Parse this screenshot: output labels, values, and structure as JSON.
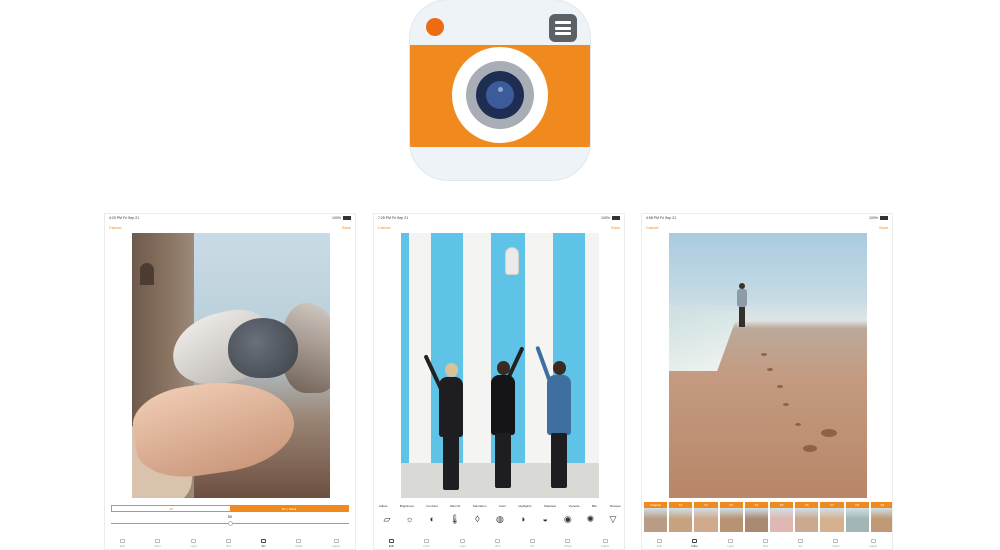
{
  "app_icon": {
    "colors": {
      "band": "#f08a1e",
      "dot": "#ee6b16",
      "menu": "#5b6167",
      "background": "#eef3f7"
    },
    "icons": [
      "camera-lens-icon",
      "menu-icon"
    ]
  },
  "screens": [
    {
      "status": {
        "time": "4:29 PM  Fri Sep 21",
        "battery": "100%"
      },
      "topbar": {
        "cancel": "Cancel",
        "save": "Save"
      },
      "adjust": {
        "left_option": "2D",
        "right_option": "3D + Mask",
        "value": "50",
        "slider_value": 50
      },
      "tabs": [
        "Edit",
        "Filter",
        "Light",
        "Blur",
        "3D",
        "Mask",
        "Adjust"
      ],
      "active_tab": 4
    },
    {
      "status": {
        "time": "7:25 PM  Fri Sep 21",
        "battery": "100%"
      },
      "topbar": {
        "cancel": "Cancel",
        "save": "Save"
      },
      "tools": [
        "Adjust",
        "Brightness",
        "Contrast",
        "Warmth",
        "Saturation",
        "Color",
        "Highlights",
        "Shadows",
        "Vignette",
        "Blur",
        "Sharpen"
      ],
      "tool_icons": [
        "crop-icon",
        "sun-icon",
        "contrast-icon",
        "thermometer-icon",
        "drop-icon",
        "tint-icon",
        "highlights-icon",
        "shadows-icon",
        "vignette-icon",
        "blur-icon",
        "triangle-icon"
      ],
      "tabs": [
        "Edit",
        "Filter",
        "Light",
        "Blur",
        "3D",
        "Mask",
        "Adjust"
      ],
      "active_tab": 0
    },
    {
      "status": {
        "time": "4:58 PM  Fri Sep 21",
        "battery": "100%"
      },
      "topbar": {
        "cancel": "Cancel",
        "save": "Save"
      },
      "filters": [
        {
          "label": "Original",
          "color": "#b89c85"
        },
        {
          "label": "F1",
          "color": "#c7a27e"
        },
        {
          "label": "F2",
          "color": "#d1a98c"
        },
        {
          "label": "F3",
          "color": "#b79374"
        },
        {
          "label": "F4",
          "color": "#a98972"
        },
        {
          "label": "F5",
          "color": "#e0b7b2"
        },
        {
          "label": "F6",
          "color": "#caa98f"
        },
        {
          "label": "F7",
          "color": "#d6b190"
        },
        {
          "label": "F8",
          "color": "#a2b6b6"
        },
        {
          "label": "F9",
          "color": "#c09a74"
        }
      ],
      "tabs": [
        "Edit",
        "Filter",
        "Light",
        "Blur",
        "3D",
        "Mask",
        "Adjust"
      ],
      "active_tab": 1
    }
  ]
}
